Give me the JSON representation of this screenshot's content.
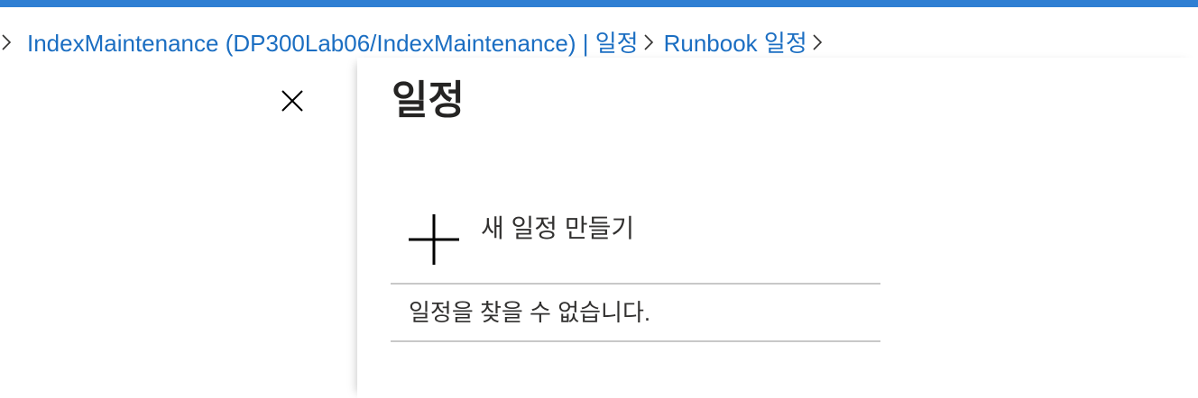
{
  "colors": {
    "accent_bar": "#2f7fd3",
    "link": "#1b6ec2",
    "divider": "#c8c8c8",
    "text": "#323130"
  },
  "breadcrumb": {
    "item1": "IndexMaintenance (DP300Lab06/IndexMaintenance)",
    "separator": "|",
    "item1_suffix": "일정",
    "item2": "Runbook 일정"
  },
  "icons": {
    "chevron": "chevron-right-icon",
    "close": "close-icon",
    "plus": "plus-icon"
  },
  "panel": {
    "title": "일정",
    "create_label": "새 일정 만들기",
    "empty_message": "일정을 찾을 수 없습니다."
  }
}
